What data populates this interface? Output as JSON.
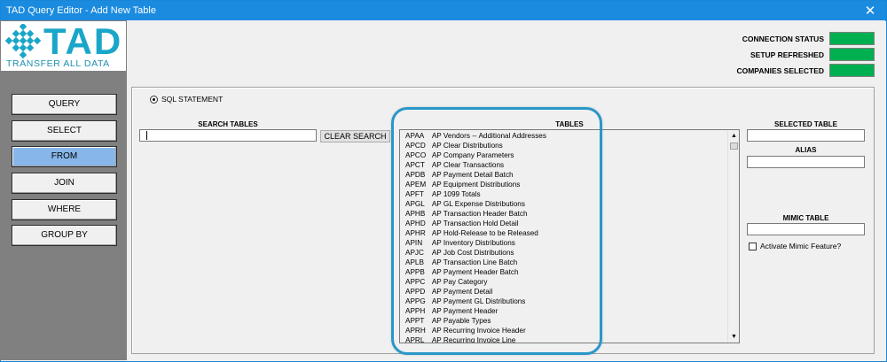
{
  "window": {
    "title": "TAD Query Editor - Add New Table",
    "close_glyph": "✕"
  },
  "logo": {
    "text": "TAD",
    "subtext": "TRANSFER ALL DATA"
  },
  "nav": {
    "items": [
      {
        "label": "QUERY",
        "active": false
      },
      {
        "label": "SELECT",
        "active": false
      },
      {
        "label": "FROM",
        "active": true
      },
      {
        "label": "JOIN",
        "active": false
      },
      {
        "label": "WHERE",
        "active": false
      },
      {
        "label": "GROUP BY",
        "active": false
      }
    ]
  },
  "status": {
    "connection": "CONNECTION STATUS",
    "setup": "SETUP REFRESHED",
    "companies": "COMPANIES SELECTED",
    "ok_color": "#00b050"
  },
  "query_mode": {
    "sql_statement_label": "SQL STATEMENT"
  },
  "search": {
    "label": "SEARCH TABLES",
    "value": "",
    "clear_label": "CLEAR SEARCH"
  },
  "tables": {
    "label": "TABLES",
    "items": [
      {
        "code": "APAA",
        "name": "AP Vendors -- Additional Addresses"
      },
      {
        "code": "APCD",
        "name": "AP Clear Distributions"
      },
      {
        "code": "APCO",
        "name": "AP Company Parameters"
      },
      {
        "code": "APCT",
        "name": "AP Clear Transactions"
      },
      {
        "code": "APDB",
        "name": "AP Payment Detail Batch"
      },
      {
        "code": "APEM",
        "name": "AP Equipment Distributions"
      },
      {
        "code": "APFT",
        "name": "AP 1099 Totals"
      },
      {
        "code": "APGL",
        "name": "AP GL Expense Distributions"
      },
      {
        "code": "APHB",
        "name": "AP Transaction Header Batch"
      },
      {
        "code": "APHD",
        "name": "AP Transaction Hold Detail"
      },
      {
        "code": "APHR",
        "name": "AP Hold-Release to be Released"
      },
      {
        "code": "APIN",
        "name": "AP Inventory Distributions"
      },
      {
        "code": "APJC",
        "name": "AP Job Cost Distributions"
      },
      {
        "code": "APLB",
        "name": "AP Transaction Line Batch"
      },
      {
        "code": "APPB",
        "name": "AP Payment Header Batch"
      },
      {
        "code": "APPC",
        "name": "AP Pay Category"
      },
      {
        "code": "APPD",
        "name": "AP Payment Detail"
      },
      {
        "code": "APPG",
        "name": "AP Payment GL Distributions"
      },
      {
        "code": "APPH",
        "name": "AP Payment Header"
      },
      {
        "code": "APPT",
        "name": "AP Payable Types"
      },
      {
        "code": "APRH",
        "name": "AP Recurring Invoice Header"
      },
      {
        "code": "APRL",
        "name": "AP Recurring Invoice Line"
      }
    ]
  },
  "selected_table": {
    "label": "SELECTED TABLE",
    "value": ""
  },
  "alias": {
    "label": "ALIAS",
    "value": ""
  },
  "mimic": {
    "label": "MIMIC TABLE",
    "value": "",
    "checkbox_label": "Activate Mimic Feature?"
  },
  "scroll": {
    "up_glyph": "▲",
    "down_glyph": "▼"
  }
}
